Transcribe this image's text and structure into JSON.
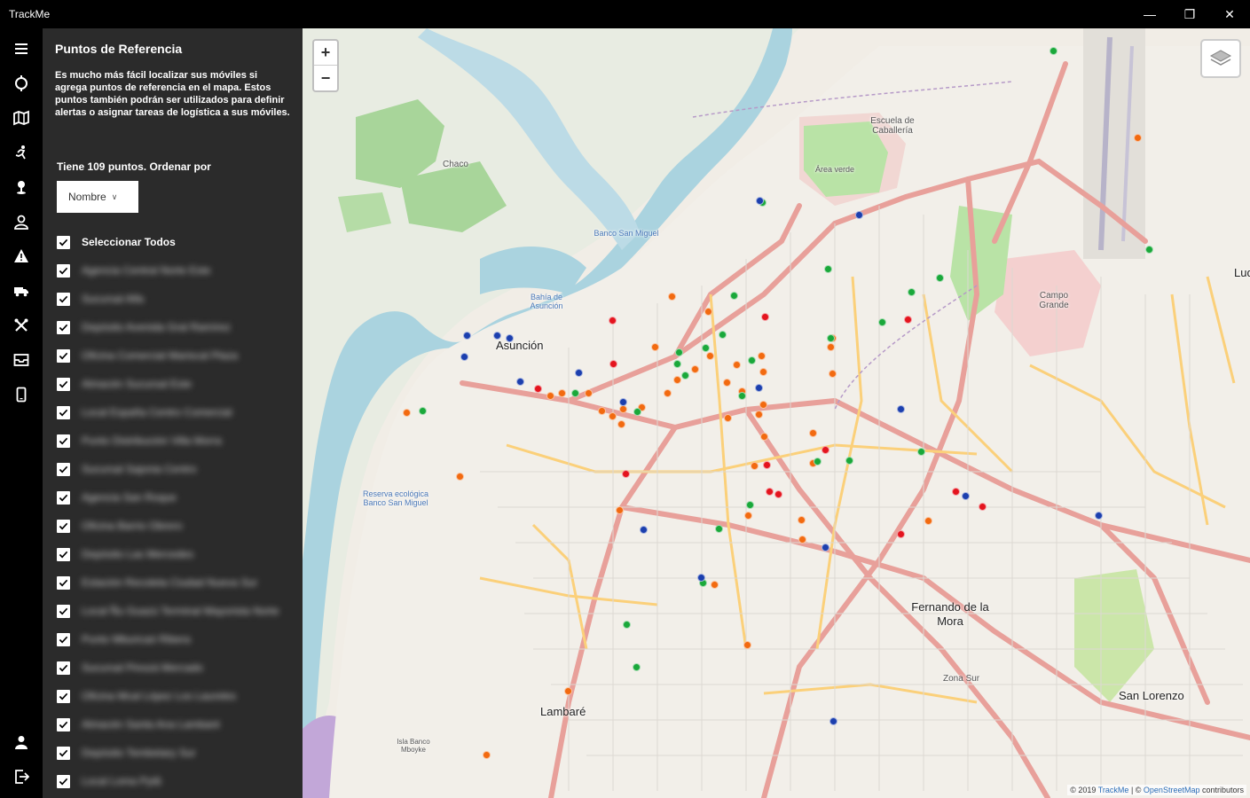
{
  "window": {
    "title": "TrackMe",
    "minimize": "—",
    "maximize": "❐",
    "close": "✕"
  },
  "rail": {
    "items": [
      {
        "icon": "hamburger-menu-icon"
      },
      {
        "icon": "target-icon"
      },
      {
        "icon": "map-icon"
      },
      {
        "icon": "running-person-icon"
      },
      {
        "icon": "location-pin-icon"
      },
      {
        "icon": "user-icon"
      },
      {
        "icon": "warning-icon"
      },
      {
        "icon": "truck-icon"
      },
      {
        "icon": "tools-icon"
      },
      {
        "icon": "inbox-icon"
      },
      {
        "icon": "mobile-device-icon"
      }
    ],
    "bottom": [
      {
        "icon": "account-icon"
      },
      {
        "icon": "sign-out-icon"
      }
    ]
  },
  "panel": {
    "title": "Puntos de Referencia",
    "description": "Es mucho más fácil localizar sus móviles si agrega puntos de referencia en el mapa. Estos puntos también podrán ser utilizados para definir alertas o asignar tareas de logística a sus móviles.",
    "count_text": "Tiene 109 puntos. Ordenar por",
    "sort_value": "Nombre",
    "select_all": "Seleccionar Todos",
    "items": [
      "Agencia Central Norte Este",
      "Sucursal Alfa",
      "Depósito Avenida Gral Ramírez",
      "Oficina Comercial Mariscal Plaza",
      "Almacén Sucursal Este",
      "Local España Centro Comercial",
      "Punto Distribución Villa Morra",
      "Sucursal Sajonia Centro",
      "Agencia San Roque",
      "Oficina Barrio Obrero",
      "Depósito Las Mercedes",
      "Estación Recoleta Ciudad Nueva Sur",
      "Local Ñu Guazú Terminal Mayorista Norte",
      "Punto Mburicaó Ribera",
      "Sucursal Pinozá Mercado",
      "Oficina Mcal López Los Laureles",
      "Almacén Santa Ana Lambaré",
      "Depósito Tembetary Sur",
      "Local Loma Pytã"
    ]
  },
  "map": {
    "zoom_in": "+",
    "zoom_out": "−",
    "attribution_year": "© 2019",
    "attribution_brand": "TrackMe",
    "attribution_sep": " | © ",
    "attribution_osm": "OpenStreetMap",
    "attribution_tail": " contributors",
    "labels": {
      "asuncion": "Asunción",
      "fernando": "Fernando de la Mora",
      "lambare": "Lambaré",
      "san_lorenzo": "San Lorenzo",
      "luque": "Luque",
      "zona_sur": "Zona Sur",
      "chaco": "Chaco",
      "campo_grande": "Campo Grande",
      "escuela": "Escuela de Caballería",
      "area_verde": "Área verde",
      "isla_banco": "Isla Banco Mboyke",
      "bahia": "Bahía de Asunción",
      "banco_san_miguel": "Banco San Miguel",
      "rio_paraguay": "Reserva ecológica Banco San Miguel"
    },
    "marker_colors": {
      "orange": "#f26a10",
      "green": "#1aa83a",
      "red": "#e4141e",
      "blue": "#1c3fae"
    },
    "markers_orange": 38,
    "markers_green": 24,
    "markers_red": 14,
    "markers_blue": 16
  }
}
